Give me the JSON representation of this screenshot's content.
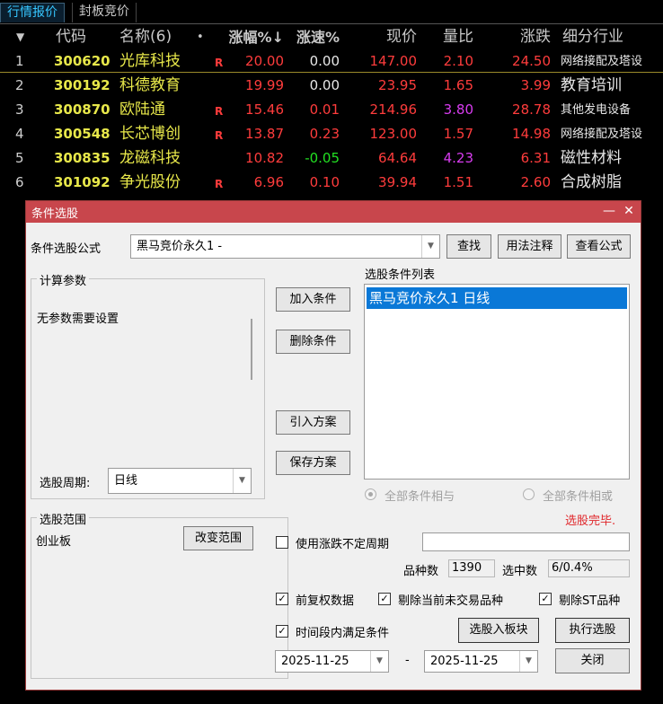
{
  "tabs": [
    {
      "label": "行情报价",
      "active": true
    },
    {
      "label": "封板竞价",
      "active": false
    }
  ],
  "quote_table": {
    "headers": {
      "sort_icon": "▼",
      "code": "代码",
      "name": "名称(6)",
      "dot": "•",
      "pct": "涨幅%↓",
      "speed": "涨速%",
      "price": "现价",
      "ratio": "量比",
      "change": "涨跌",
      "industry": "细分行业"
    },
    "rows": [
      {
        "idx": "1",
        "code": "300620",
        "name": "光库科技",
        "r": "R",
        "pct": "20.00",
        "speed": "0.00",
        "speed_color": "white",
        "price": "147.00",
        "ratio": "2.10",
        "ratio_color": "red",
        "change": "24.50",
        "industry": "网络接配及塔设",
        "industry_small": true
      },
      {
        "idx": "2",
        "code": "300192",
        "name": "科德教育",
        "r": "",
        "pct": "19.99",
        "speed": "0.00",
        "speed_color": "white",
        "price": "23.95",
        "ratio": "1.65",
        "ratio_color": "red",
        "change": "3.99",
        "industry": "教育培训",
        "industry_small": false
      },
      {
        "idx": "3",
        "code": "300870",
        "name": "欧陆通",
        "r": "R",
        "pct": "15.46",
        "speed": "0.01",
        "speed_color": "red",
        "price": "214.96",
        "ratio": "3.80",
        "ratio_color": "magenta",
        "change": "28.78",
        "industry": "其他发电设备",
        "industry_small": true
      },
      {
        "idx": "4",
        "code": "300548",
        "name": "长芯博创",
        "r": "R",
        "pct": "13.87",
        "speed": "0.23",
        "speed_color": "red",
        "price": "123.00",
        "ratio": "1.57",
        "ratio_color": "red",
        "change": "14.98",
        "industry": "网络接配及塔设",
        "industry_small": true
      },
      {
        "idx": "5",
        "code": "300835",
        "name": "龙磁科技",
        "r": "",
        "pct": "10.82",
        "speed": "-0.05",
        "speed_color": "green",
        "price": "64.64",
        "ratio": "4.23",
        "ratio_color": "magenta",
        "change": "6.31",
        "industry": "磁性材料",
        "industry_small": false
      },
      {
        "idx": "6",
        "code": "301092",
        "name": "争光股份",
        "r": "R",
        "pct": "6.96",
        "speed": "0.10",
        "speed_color": "red",
        "price": "39.94",
        "ratio": "1.51",
        "ratio_color": "red",
        "change": "2.60",
        "industry": "合成树脂",
        "industry_small": false
      }
    ]
  },
  "dialog": {
    "title": "条件选股",
    "minimize_glyph": "—",
    "close_glyph": "✕",
    "formula_label": "条件选股公式",
    "formula_value": "黑马竞价永久1  -",
    "find_label": "查找",
    "usage_label": "用法注释",
    "view_formula_label": "查看公式",
    "params_group_title": "计算参数",
    "params_text": "无参数需要设置",
    "period_label": "选股周期:",
    "period_value": "日线",
    "add_condition_label": "加入条件",
    "delete_condition_label": "删除条件",
    "import_plan_label": "引入方案",
    "save_plan_label": "保存方案",
    "condition_list_title": "选股条件列表",
    "condition_items": [
      "黑马竞价永久1  日线"
    ],
    "radio_and_label": "全部条件相与",
    "radio_or_label": "全部条件相或",
    "status_text": "选股完毕.",
    "range_group_title": "选股范围",
    "range_value": "创业板",
    "change_range_label": "改变范围",
    "use_period_label": "使用涨跌不定周期",
    "count_label": "品种数",
    "count_value": "1390",
    "selected_label": "选中数",
    "selected_value": "6/0.4%",
    "adjusted_label": "前复权数据",
    "exclude_untraded_label": "剔除当前未交易品种",
    "exclude_st_label": "剔除ST品种",
    "time_range_label": "时间段内满足条件",
    "add_to_block_label": "选股入板块",
    "execute_label": "执行选股",
    "date_from": "2025-11-25",
    "date_separator": "-",
    "date_to": "2025-11-25",
    "close_label": "关闭",
    "checkmark": "✓"
  }
}
